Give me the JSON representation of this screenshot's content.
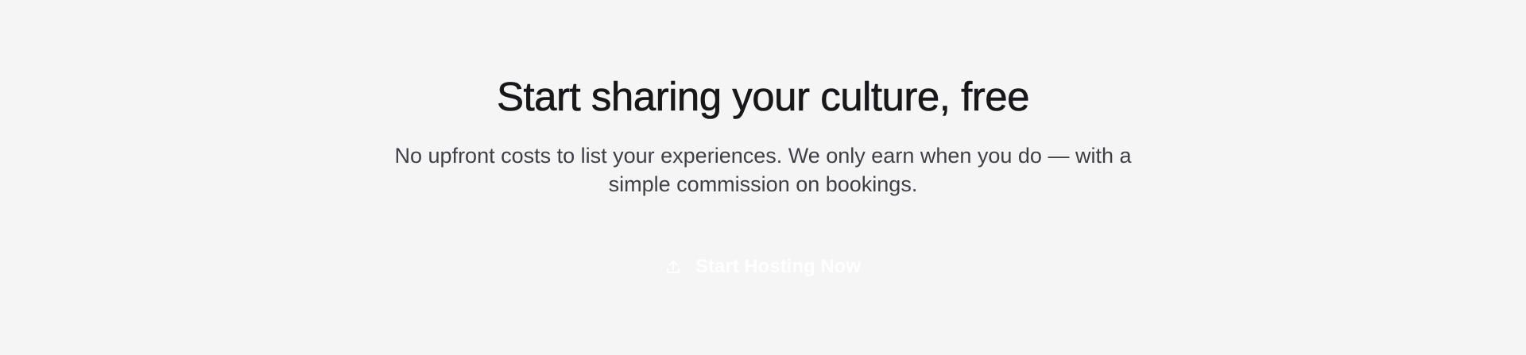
{
  "hero": {
    "title": "Start sharing your culture, free",
    "subtitle": "No upfront costs to list your experiences. We only earn when you do — with a simple commission on bookings.",
    "cta": {
      "label": "Start Hosting Now",
      "icon": "upload-icon"
    }
  },
  "colors": {
    "background": "#f5f5f5",
    "title": "#18181b",
    "subtitle": "#3f3f46",
    "cta_text": "#ffffff"
  }
}
